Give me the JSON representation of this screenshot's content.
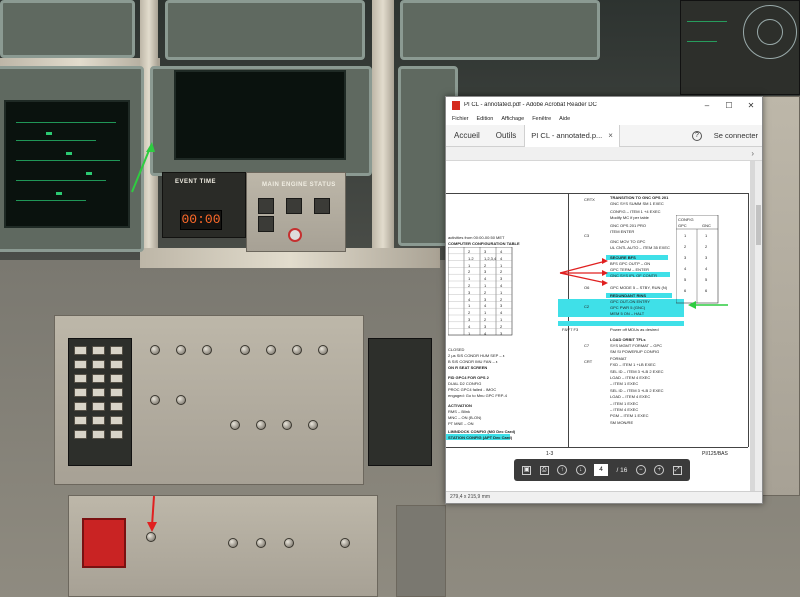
{
  "cockpit": {
    "event_time_label": "EVENT TIME",
    "event_time_value": "00:00",
    "main_engine_status_label": "MAIN ENGINE STATUS"
  },
  "acrobat": {
    "window_title": "PI CL - annotated.pdf - Adobe Acrobat Reader DC",
    "menus": [
      "Fichier",
      "Edition",
      "Affichage",
      "Fenêtre",
      "Aide"
    ],
    "tabs": {
      "home": "Accueil",
      "tools": "Outils",
      "document": "PI CL - annotated.p..."
    },
    "connect_label": "Se connecter",
    "page_number": "4",
    "page_total": "/ 16",
    "status_text": "279,4 x 215,9 mm",
    "page_footer_left": "1-3",
    "page_footer_right": "PI/125/BAS",
    "pdf_left_lines": [
      "activities from 00:00-00:50 MET",
      "COMPUTER CONFIGURATION TABLE",
      "CLOSED",
      "2 µs SIS CONDR HUM SEP – ε",
      "B SIS CONDR IMU FAN – ε",
      "ON R SEAT SCREEN",
      "FID GPC4 FOR OPS 2",
      "DUAL D2 CONFIG",
      "PROC GPC4 failed - IMOC",
      "engaged: Go to Mnu GPC FRP-4",
      "ACTIVATION",
      "RMS – Blink",
      "MNC – ON (B-ON)",
      "PT MNE – ON",
      "LIMNDOCK CONFIG (MG Dec Card)",
      "STATION CONFIG (APT Dec Card)"
    ],
    "pdf_right_lines": {
      "crtx": "CRTX",
      "transition": "TRANSITION TO GNC OPS 201",
      "gnc_sys": "GNC SYS SUMM SM 1 EXEC",
      "config": "CONFIG – ITEM 1 +4 EXEC",
      "modify": "Modify MC if per table",
      "gnc_201": "GNC OPS 201 PRO",
      "item_ent": "ITEM ENTER",
      "gnc_mov": "GNC MOV TO GPC",
      "iguana": "UL CNTL AUTO – ITEM 35 EXEC",
      "c3": "C3",
      "secure": "SECURE BFS",
      "bfs_off": "BFS GPC OUTP – ON",
      "gpc_term": "GPC TERM – ENTER",
      "gnc_mem": "GNC SYS IPL OF CONTR",
      "gpc_nom": "GPC MODE 5 – STBY, RUN (N)",
      "c6": "O6",
      "redund": "REDUNDANT RINS",
      "hl_1": "GPC OUT-ON ENTRY",
      "hl_2": "GPC PWR 5 (GNC)",
      "hl_3": "MEM 5 ON – HALT",
      "c2": "C2",
      "power_on": "Power off MDUs as desired",
      "f8": "F8/F7 F3",
      "load_orbit": "LOAD ORBIT TFLs",
      "c7": "C7",
      "crt": "CRT",
      "crt_lines": [
        "SYS MGMT FORMAT – GPC",
        "SM SI POWERUP CONFIG",
        "FORMAT",
        "FXD   – ITEM 1 +LB EXEC",
        "SEL ID – ITEM 3 +LB 2 EXEC",
        "LOAD  – ITEM 4 EXEC",
        "        – ITEM 1 EXEC",
        "SEL ID – ITEM 3 +LB 2 EXEC",
        "LOAD  – ITEM 4 EXEC",
        "        – ITEM 1 EXEC",
        "        – ITEM 4 EXEC",
        "PGM  – ITEM 1 EXEC",
        "SM MON/RE"
      ],
      "table_header": [
        "CONFIG",
        "GPC",
        "GNC"
      ],
      "table_rows": [
        [
          "1",
          "1",
          "1"
        ],
        [
          "2",
          "2",
          "2"
        ],
        [
          "3",
          "3",
          "3"
        ],
        [
          "4",
          "4",
          "4"
        ],
        [
          "5",
          "5",
          "5"
        ],
        [
          "6",
          "6",
          "6"
        ]
      ]
    },
    "pdf_config_table": {
      "header": [
        "",
        "2",
        "3",
        "4"
      ],
      "rows": [
        [
          "",
          "1.2",
          "1,2,3,4",
          "4"
        ],
        [
          "",
          "1",
          "2",
          "1"
        ],
        [
          "",
          "2",
          "3",
          "2"
        ],
        [
          "",
          "1",
          "4",
          "3"
        ],
        [
          "",
          "2",
          "1",
          "4"
        ],
        [
          "",
          "3",
          "2",
          "1"
        ],
        [
          "",
          "4",
          "3",
          "2"
        ],
        [
          "",
          "1",
          "4",
          "3"
        ],
        [
          "",
          "2",
          "1",
          "4"
        ],
        [
          "",
          "3",
          "2",
          "1"
        ],
        [
          "",
          "4",
          "3",
          "2"
        ],
        [
          "",
          "1",
          "4",
          "3"
        ]
      ]
    }
  },
  "colors": {
    "highlight": "#3fe0e8",
    "annotation_red": "#e02020",
    "annotation_green": "#2ecc40",
    "event_time_digits": "#ff6a2a"
  }
}
